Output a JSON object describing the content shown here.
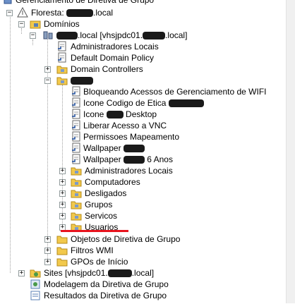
{
  "app_title": "Gerenciamento de Diretiva de Grupo",
  "forest": {
    "prefix": "Floresta: ",
    "suffix": ".local"
  },
  "domains_label": "Domínios",
  "domain": {
    "prefix": "",
    "middle": ".local [vhsjpdc01.",
    "suffix": ".local]"
  },
  "gpo_links": [
    "Administradores Locais",
    "Default Domain Policy"
  ],
  "domain_controllers": "Domain Controllers",
  "ou_gpos": [
    {
      "prefix": "Bloqueando Acessos de Gerenciamento de WIFI",
      "suffix": ""
    },
    {
      "prefix": "Icone Codigo de Etica ",
      "suffix": ""
    },
    {
      "prefix": "Icone ",
      "suffix": " Desktop"
    },
    {
      "prefix": "Liberar Acesso a VNC",
      "suffix": ""
    },
    {
      "prefix": "Permissoes Mapeamento",
      "suffix": ""
    },
    {
      "prefix": "Wallpaper ",
      "suffix": ""
    },
    {
      "prefix": "Wallpaper ",
      "suffix": " 6 Anos"
    }
  ],
  "sub_ous": [
    "Administradores Locais",
    "Computadores",
    "Desligados",
    "Grupos",
    "Servicos",
    "Usuarios"
  ],
  "domain_children": [
    "Objetos de Diretiva de Grupo",
    "Filtros WMI",
    "GPOs de Início"
  ],
  "sites": {
    "prefix": "Sites [vhsjpdc01.",
    "suffix": ".local]"
  },
  "modeling": "Modelagem da Diretiva de Grupo",
  "results": "Resultados da Diretiva de Grupo",
  "colors": {
    "highlight": "#e8141e",
    "folder": "#f2c94c",
    "redaction": "#1a1a1a"
  },
  "icons": {
    "expanded": "−",
    "collapsed": "+"
  }
}
